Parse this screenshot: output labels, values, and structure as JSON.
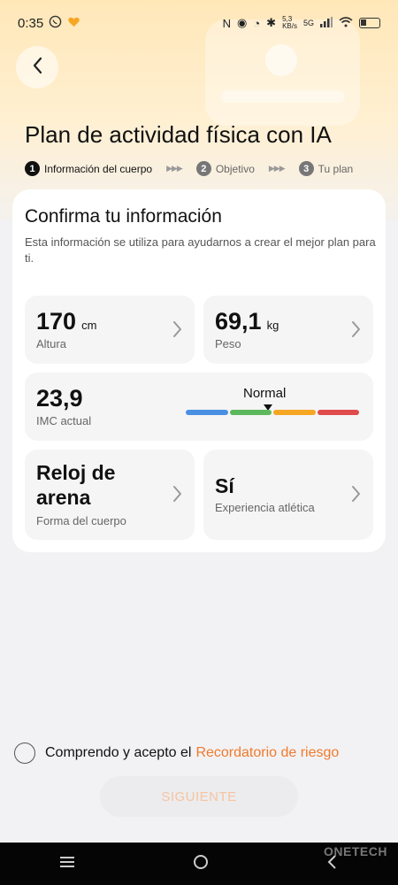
{
  "status_bar": {
    "time": "0:35",
    "net_speed": "5,3",
    "net_unit": "KB/s",
    "network": "5G"
  },
  "header": {
    "title": "Plan de actividad física con IA"
  },
  "steps": [
    {
      "num": "1",
      "label": "Información del cuerpo",
      "active": true
    },
    {
      "num": "2",
      "label": "Objetivo",
      "active": false
    },
    {
      "num": "3",
      "label": "Tu plan",
      "active": false
    }
  ],
  "card": {
    "title": "Confirma tu información",
    "description": "Esta información se utiliza para ayudarnos a crear el mejor plan para ti.",
    "height": {
      "value": "170",
      "unit": "cm",
      "label": "Altura"
    },
    "weight": {
      "value": "69,1",
      "unit": "kg",
      "label": "Peso"
    },
    "bmi": {
      "value": "23,9",
      "label": "IMC actual",
      "status": "Normal",
      "scale_colors": [
        "#4a90e2",
        "#5cb85c",
        "#f5a623",
        "#e04b4b"
      ]
    },
    "body_shape": {
      "value": "Reloj de arena",
      "label": "Forma del cuerpo"
    },
    "athletic_experience": {
      "value": "Sí",
      "label": "Experiencia atlética"
    }
  },
  "consent": {
    "text": "Comprendo y acepto el",
    "link": "Recordatorio de riesgo"
  },
  "next_button": {
    "label": "SIGUIENTE"
  },
  "watermark": "ONETECH"
}
